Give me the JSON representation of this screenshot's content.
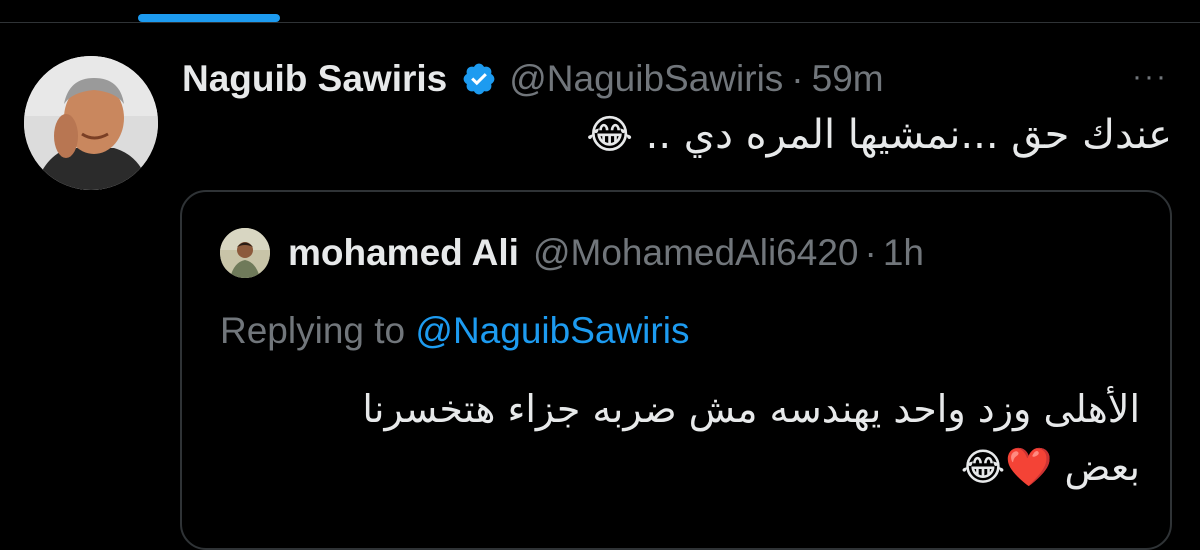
{
  "colors": {
    "background": "#000000",
    "text": "#e7e9ea",
    "muted": "#71767b",
    "accent": "#1d9bf0",
    "border": "#2f3336"
  },
  "tweet": {
    "author_name": "Naguib Sawiris",
    "verified_icon": "verified-badge-icon",
    "handle": "@NaguibSawiris",
    "separator": "·",
    "time": "59m",
    "more_icon": "more-options-icon",
    "more_glyph": "···",
    "text": "عندك حق ...نمشيها المره دي .. 😂"
  },
  "quoted_tweet": {
    "author_name": "mohamed Ali",
    "handle": "@MohamedAli6420",
    "separator": "·",
    "time": "1h",
    "replying_prefix": "Replying to ",
    "replying_to": "@NaguibSawiris",
    "text": "الأهلى وزد واحد يهندسه مش ضربه جزاء هتخسرنا بعض ❤️😂"
  }
}
